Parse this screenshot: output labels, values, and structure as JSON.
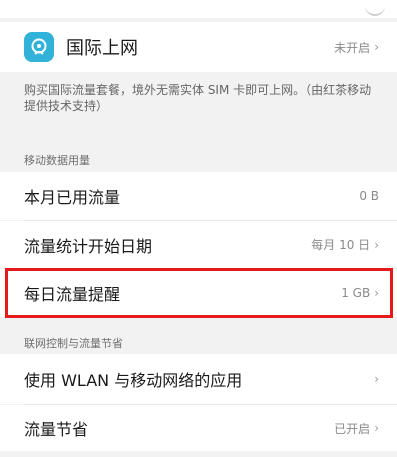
{
  "intl_roaming": {
    "title": "国际上网",
    "status": "未开启",
    "description": "购买国际流量套餐，境外无需实体 SIM 卡即可上网。（由红茶移动提供技术支持）"
  },
  "sections": {
    "mobile_data": "移动数据用量",
    "network_control": "联网控制与流量节省"
  },
  "items": {
    "used_this_month": {
      "label": "本月已用流量",
      "value": "0 B"
    },
    "stats_start_date": {
      "label": "流量统计开始日期",
      "value": "每月 10 日"
    },
    "daily_reminder": {
      "label": "每日流量提醒",
      "value": "1 GB"
    },
    "wlan_apps": {
      "label": "使用 WLAN 与移动网络的应用",
      "value": ""
    },
    "data_saver": {
      "label": "流量节省",
      "value": "已开启"
    }
  },
  "colors": {
    "accent": "#31b3d9",
    "highlight": "#e51a1a"
  }
}
